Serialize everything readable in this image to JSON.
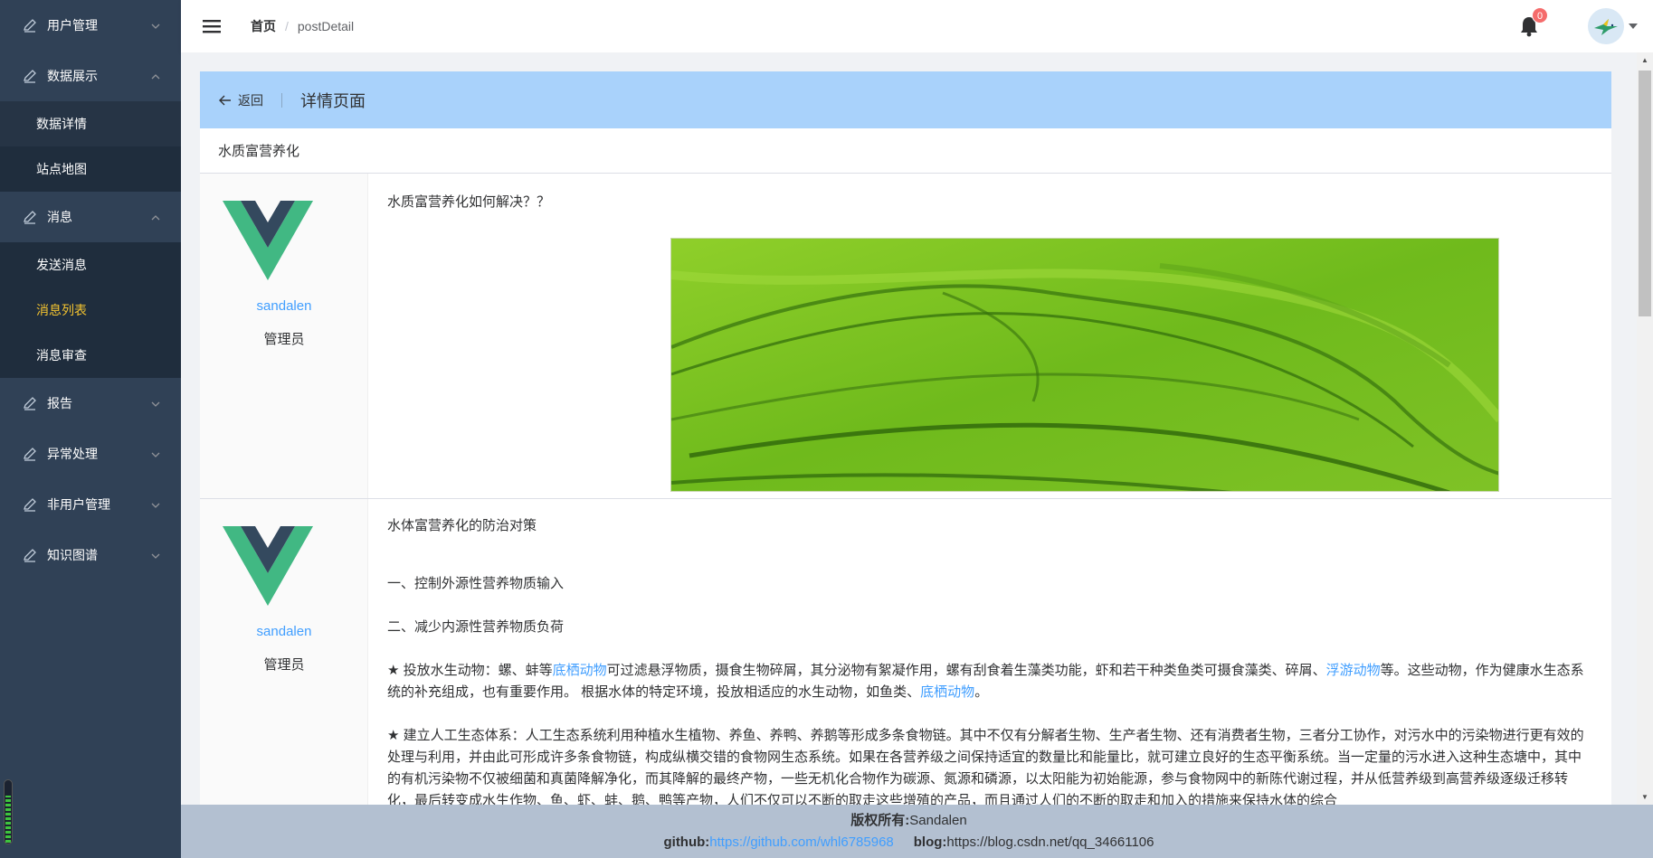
{
  "sidebar": {
    "menus": [
      {
        "label": "用户管理",
        "expanded": false
      },
      {
        "label": "数据展示",
        "expanded": true,
        "children": [
          "数据详情",
          "站点地图"
        ]
      },
      {
        "label": "消息",
        "expanded": true,
        "children": [
          "发送消息",
          "消息列表",
          "消息审查"
        ],
        "active": "消息列表"
      },
      {
        "label": "报告",
        "expanded": false
      },
      {
        "label": "异常处理",
        "expanded": false
      },
      {
        "label": "非用户管理",
        "expanded": false
      },
      {
        "label": "知识图谱",
        "expanded": false
      }
    ]
  },
  "navbar": {
    "breadcrumb_home": "首页",
    "breadcrumb_sep": "/",
    "breadcrumb_current": "postDetail",
    "notification_count": "0"
  },
  "page_header": {
    "back_label": "返回",
    "title": "详情页面"
  },
  "post_title": "水质富营养化",
  "posts": [
    {
      "author": "sandalen",
      "role": "管理员",
      "question": "水质富营养化如何解决？？"
    },
    {
      "author": "sandalen",
      "role": "管理员",
      "heading": "水体富营养化的防治对策",
      "item1": "一、控制外源性营养物质输入",
      "item2": "二、减少内源性营养物质负荷",
      "para1_a": "★ 投放水生动物：螺、蚌等",
      "para1_link1": "底栖动物",
      "para1_b": "可过滤悬浮物质，摄食生物碎屑，其分泌物有絮凝作用，螺有刮食着生藻类功能，虾和若干种类鱼类可摄食藻类、碎屑、",
      "para1_link2": "浮游动物",
      "para1_c": "等。这些动物，作为健康水生态系统的补充组成，也有重要作用。 根据水体的特定环境，投放相适应的水生动物，如鱼类、",
      "para1_link3": "底栖动物",
      "para1_d": "。",
      "para2": "★ 建立人工生态体系：人工生态系统利用种植水生植物、养鱼、养鸭、养鹅等形成多条食物链。其中不仅有分解者生物、生产者生物、还有消费者生物，三者分工协作，对污水中的污染物进行更有效的处理与利用，并由此可形成许多条食物链，构成纵横交错的食物网生态系统。如果在各营养级之间保持适宜的数量比和能量比，就可建立良好的生态平衡系统。当一定量的污水进入这种生态塘中，其中的有机污染物不仅被细菌和真菌降解净化，而其降解的最终产物，一些无机化合物作为碳源、氮源和磷源，以太阳能为初始能源，参与食物网中的新陈代谢过程，并从低营养级到高营养级逐级迁移转化，最后转变成水生作物、鱼、虾、蚌、鹅、鸭等产物，人们不仅可以不断的取走这些增殖的产品，而且通过人们的不断的取走和加入的措施来保持水体的综合"
    }
  ],
  "footer": {
    "copyright_label": "版权所有:",
    "copyright_value": "Sandalen",
    "github_label": "github:",
    "github_url": "https://github.com/whl6785968",
    "blog_label": "blog:",
    "blog_url": "https://blog.csdn.net/qq_34661106"
  },
  "colors": {
    "sidebar_bg": "#304156",
    "active_menu": "#f4c430",
    "header_bg": "#a9d2fb",
    "footer_bg": "#b3c0d1",
    "link": "#409eff",
    "badge": "#f56c6c"
  },
  "meter_level": 0.75
}
